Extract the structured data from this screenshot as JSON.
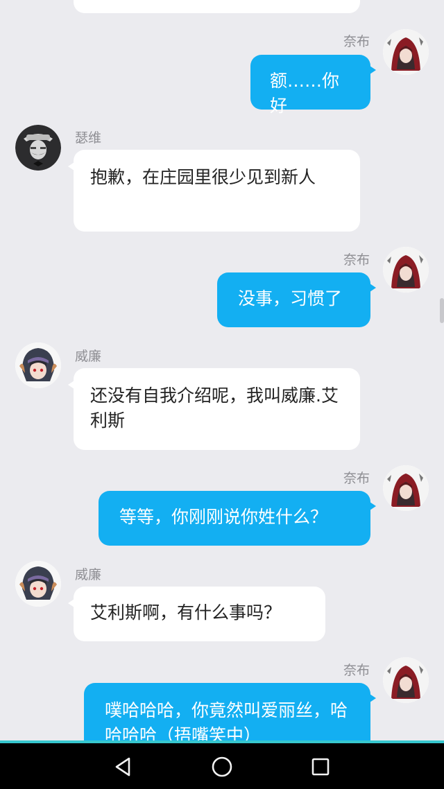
{
  "messages": [
    {
      "side": "left",
      "name": "",
      "text": ""
    },
    {
      "side": "right",
      "name": "奈布",
      "text": "额……你好"
    },
    {
      "side": "left",
      "name": "瑟维",
      "text": "抱歉，在庄园里很少见到新人"
    },
    {
      "side": "right",
      "name": "奈布",
      "text": "没事，习惯了"
    },
    {
      "side": "left",
      "name": "威廉",
      "text": "还没有自我介绍呢，我叫威廉.艾利斯"
    },
    {
      "side": "right",
      "name": "奈布",
      "text": "等等，你刚刚说你姓什么？"
    },
    {
      "side": "left",
      "name": "威廉",
      "text": "艾利斯啊，有什么事吗？"
    },
    {
      "side": "right",
      "name": "奈布",
      "text": "噗哈哈哈，你竟然叫爱丽丝，哈哈哈哈（捂嘴笑中）"
    }
  ],
  "colors": {
    "background": "#ebebef",
    "outgoing_bubble": "#13aff2",
    "incoming_bubble": "#ffffff",
    "nav_accent": "#37c7cf"
  },
  "avatars": {
    "nabu": "hooded-red-avatar-icon",
    "servet": "hat-mustache-avatar-icon",
    "william": "helmet-avatar-icon"
  },
  "navbar": {
    "back": "back-triangle-icon",
    "home": "home-circle-icon",
    "recents": "recents-square-icon"
  }
}
